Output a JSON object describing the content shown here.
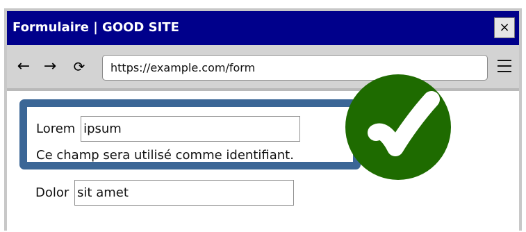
{
  "window": {
    "title": "Formulaire | GOOD SITE",
    "close_label": "×"
  },
  "toolbar": {
    "back_label": "←",
    "forward_label": "→",
    "reload_label": "⟳",
    "url": "https://example.com/form",
    "menu_icon": "hamburger-menu-icon"
  },
  "form": {
    "field1": {
      "label": "Lorem",
      "value": "ipsum",
      "helper": "Ce champ sera utilisé comme identifiant."
    },
    "field2": {
      "label": "Dolor",
      "value": "sit amet"
    }
  },
  "indicator": {
    "icon": "checkmark-icon",
    "color": "#1e6b00",
    "highlight_color": "#3b6696"
  }
}
